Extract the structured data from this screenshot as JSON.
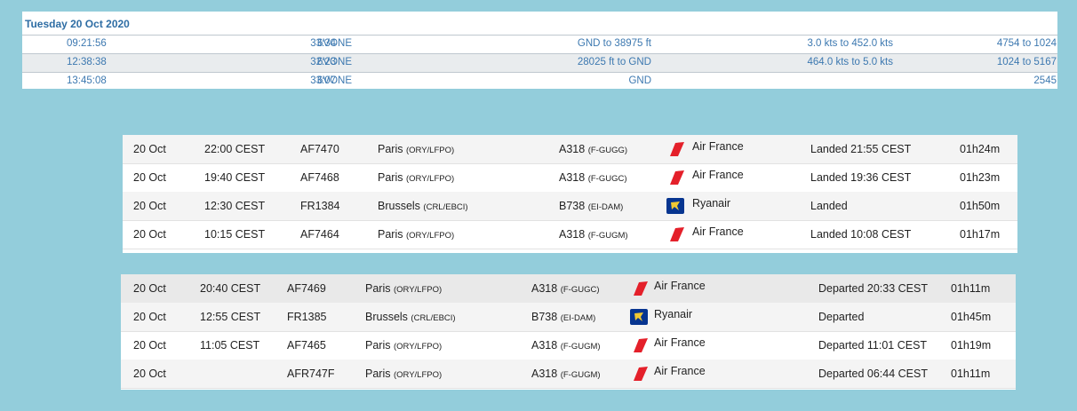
{
  "history": {
    "date": "Tuesday 20 Oct 2020",
    "rows": [
      {
        "time": "09:21:56",
        "duration": "33:34",
        "flight": "6VONE",
        "altitude": "GND to 38975 ft",
        "speed": "3.0 kts to 452.0 kts",
        "squawk": "4754 to 1024"
      },
      {
        "time": "12:38:38",
        "duration": "32:23",
        "flight": "6VONE",
        "altitude": "28025 ft to GND",
        "speed": "464.0 kts to 5.0 kts",
        "squawk": "1024 to 5167"
      },
      {
        "time": "13:45:08",
        "duration": "33:07",
        "flight": "6VONE",
        "altitude": "GND",
        "speed": "",
        "squawk": "2545"
      }
    ]
  },
  "arrivals": [
    {
      "date": "20 Oct",
      "time": "22:00 CEST",
      "flight": "AF7470",
      "city": "Paris",
      "codes": "(ORY/LFPO)",
      "aircraft": "A318",
      "reg": "(F-GUGG)",
      "airline": "Air France",
      "logo": "air-france-logo",
      "status": "Landed 21:55 CEST",
      "duration": "01h24m"
    },
    {
      "date": "20 Oct",
      "time": "19:40 CEST",
      "flight": "AF7468",
      "city": "Paris",
      "codes": "(ORY/LFPO)",
      "aircraft": "A318",
      "reg": "(F-GUGC)",
      "airline": "Air France",
      "logo": "air-france-logo",
      "status": "Landed 19:36 CEST",
      "duration": "01h23m"
    },
    {
      "date": "20 Oct",
      "time": "12:30 CEST",
      "flight": "FR1384",
      "city": "Brussels",
      "codes": "(CRL/EBCI)",
      "aircraft": "B738",
      "reg": "(EI-DAM)",
      "airline": "Ryanair",
      "logo": "ryanair-logo",
      "status": "Landed",
      "duration": "01h50m"
    },
    {
      "date": "20 Oct",
      "time": "10:15 CEST",
      "flight": "AF7464",
      "city": "Paris",
      "codes": "(ORY/LFPO)",
      "aircraft": "A318",
      "reg": "(F-GUGM)",
      "airline": "Air France",
      "logo": "air-france-logo",
      "status": "Landed 10:08 CEST",
      "duration": "01h17m"
    }
  ],
  "departures": [
    {
      "date": "20 Oct",
      "time": "20:40 CEST",
      "flight": "AF7469",
      "city": "Paris",
      "codes": "(ORY/LFPO)",
      "aircraft": "A318",
      "reg": "(F-GUGC)",
      "airline": "Air France",
      "logo": "air-france-logo",
      "status": "Departed 20:33 CEST",
      "duration": "01h11m"
    },
    {
      "date": "20 Oct",
      "time": "12:55 CEST",
      "flight": "FR1385",
      "city": "Brussels",
      "codes": "(CRL/EBCI)",
      "aircraft": "B738",
      "reg": "(EI-DAM)",
      "airline": "Ryanair",
      "logo": "ryanair-logo",
      "status": "Departed",
      "duration": "01h45m"
    },
    {
      "date": "20 Oct",
      "time": "11:05 CEST",
      "flight": "AF7465",
      "city": "Paris",
      "codes": "(ORY/LFPO)",
      "aircraft": "A318",
      "reg": "(F-GUGM)",
      "airline": "Air France",
      "logo": "air-france-logo",
      "status": "Departed 11:01 CEST",
      "duration": "01h19m"
    },
    {
      "date": "20 Oct",
      "time": "",
      "flight": "AFR747F",
      "city": "Paris",
      "codes": "(ORY/LFPO)",
      "aircraft": "A318",
      "reg": "(F-GUGM)",
      "airline": "Air France",
      "logo": "air-france-logo",
      "status": "Departed 06:44 CEST",
      "duration": "01h11m"
    }
  ],
  "colors": {
    "background": "#93cddb",
    "link_blue": "#3c78b0",
    "air_france_red": "#e4202a",
    "ryanair_navy": "#073590",
    "ryanair_yellow": "#f1c933"
  }
}
